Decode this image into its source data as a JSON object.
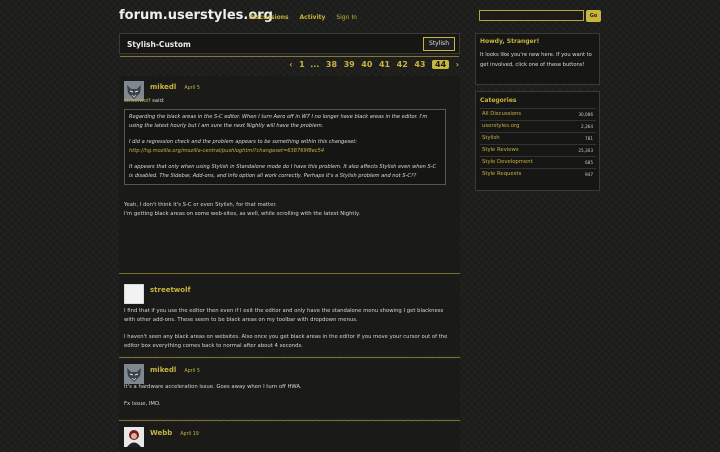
{
  "header": {
    "site_title": "forum.userstyles.org",
    "nav": [
      "Discussions",
      "Activity",
      "Sign In"
    ],
    "search_placeholder": "",
    "go_label": "Go"
  },
  "topic": {
    "title": "Stylish-Custom",
    "tag": "Stylish"
  },
  "pager": {
    "prev": "‹",
    "first": "1",
    "ellipsis": "...",
    "pages": [
      "38",
      "39",
      "40",
      "41",
      "42",
      "43"
    ],
    "current": "44",
    "next": "›"
  },
  "posts": [
    {
      "author": "mikedl",
      "date": "April 5",
      "quote_author": "streetwolf",
      "quote_said": "said:",
      "quote_p1": "Regarding the black areas in the S-C editor. When I turn Aero off in W7 I no longer have black areas in the editor. I'm using the latest hourly but I am sure the next Nightly will have the problem.",
      "quote_p2_text": "I did a regression check and the problem appears to be something within this changeset:",
      "quote_p2_link": "http://hg.mozilla.org/mozilla-central/pushloghtml?changeset=638769f8ec54",
      "quote_p3": "It appears that only when using Stylish in Standalone mode do I have this problem. It also affects Stylish even when S-C is disabled. The Sidebar, Add-ons, and Info option all work correctly. Perhaps it's a Stylish problem and not S-C??",
      "body_l1": "Yeah, I don't think it's S-C or even Stylish, for that matter.",
      "body_l2": "I'm getting black areas on some web-sites, as well, while scrolling with the latest Nightly."
    },
    {
      "author": "streetwolf",
      "date": "",
      "body_p1": "I find that if you use the editor then even if I exit the editor and only have the standalone menu showing I get blackness with other add-ons. These seem to be black areas on my toolbar with dropdown menus.",
      "body_p2": "I haven't seen any black areas on websites. Also once you get black areas in the editor if you move your cursor out of the editor box everything comes back to normal after about 4 seconds."
    },
    {
      "author": "mikedl",
      "date": "April 5",
      "body_l1": "It's a hardware acceleration issue. Goes away when I turn off HWA.",
      "body_l2": "Fx issue, IMO."
    },
    {
      "author": "Webb",
      "date": "April 19"
    }
  ],
  "sidebar": {
    "guest_title": "Howdy, Stranger!",
    "guest_text": "It looks like you're new here. If you want to get involved, click one of these buttons!",
    "categories_title": "Categories",
    "categories": [
      {
        "name": "All Discussions",
        "count": "30,086"
      },
      {
        "name": "userstyles.org",
        "count": "2,364"
      },
      {
        "name": "Stylish",
        "count": "781"
      },
      {
        "name": "Style Reviews",
        "count": "25,303"
      },
      {
        "name": "Style Development",
        "count": "685"
      },
      {
        "name": "Style Requests",
        "count": "947"
      }
    ]
  },
  "colors": {
    "accent": "#c9b53c",
    "background": "#1e1e1c",
    "panel": "#1a1a18"
  }
}
